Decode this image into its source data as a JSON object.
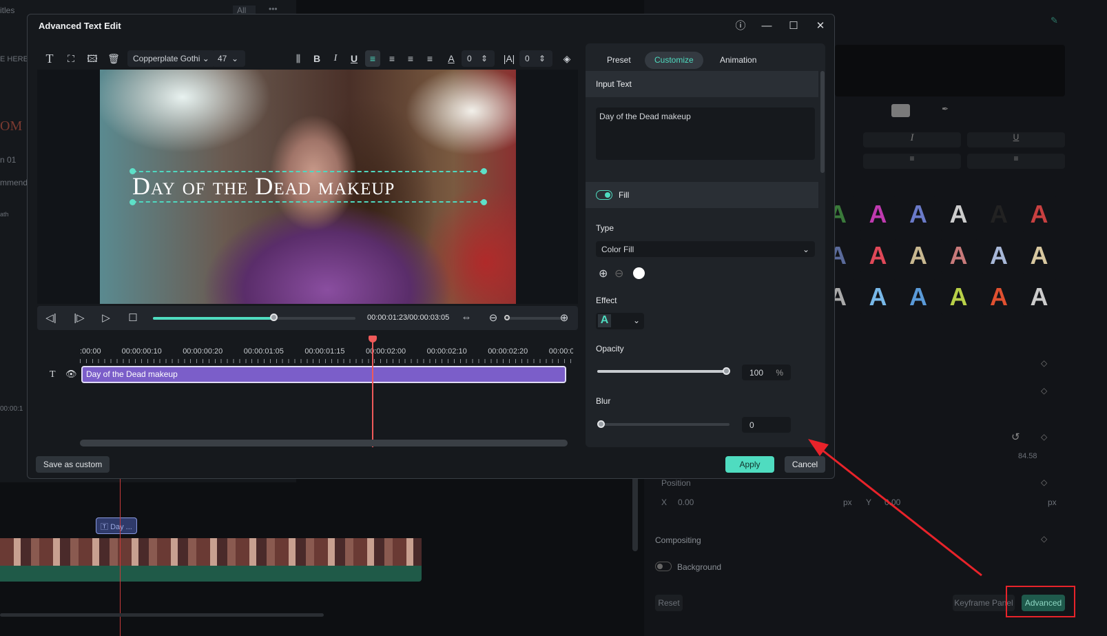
{
  "background": {
    "left_panel": {
      "titles": "itles",
      "all_filter": "All",
      "more": "•••",
      "e_here": "E HERE",
      "item1": "n 01",
      "recommend": "mmend",
      "ath": "ath",
      "timecode": "00:00:1"
    },
    "right_panel": {
      "scale_value": "84.58",
      "position_label": "Position",
      "x_label": "X",
      "x_value": "0.00",
      "x_unit": "px",
      "y_label": "Y",
      "y_value": "0.00",
      "y_unit": "px",
      "compositing_label": "Compositing",
      "background_label": "Background",
      "reset_label": "Reset",
      "keyframe_panel_label": "Keyframe Panel",
      "advanced_label": "Advanced",
      "style_glyph": "A"
    },
    "timeline": {
      "text_clip_label": "Day ..."
    }
  },
  "dialog": {
    "title": "Advanced Text Edit",
    "toolbar": {
      "font": "Copperplate Gothi",
      "size": "47",
      "char_spacing": "0",
      "line_spacing": "0"
    },
    "preview": {
      "caption": "Day of the Dead makeup"
    },
    "playback": {
      "timecode": "00:00:01:23/00:00:03:05",
      "progress_percent": 60
    },
    "timeline": {
      "ticks": [
        ":00:00",
        "00:00:00:10",
        "00:00:00:20",
        "00:00:01:05",
        "00:00:01:15",
        "00:00:02:00",
        "00:00:02:10",
        "00:00:02:20",
        "00:00:0"
      ],
      "clip_label": "Day of the Dead makeup"
    },
    "tabs": [
      {
        "label": "Preset"
      },
      {
        "label": "Customize",
        "active": true
      },
      {
        "label": "Animation"
      }
    ],
    "panel": {
      "input_text_header": "Input Text",
      "input_text_value": "Day of the Dead makeup",
      "fill_label": "Fill",
      "fill_enabled": true,
      "type_label": "Type",
      "type_value": "Color Fill",
      "fill_color": "#ffffff",
      "effect_label": "Effect",
      "effect_glyph": "A",
      "opacity_label": "Opacity",
      "opacity_value": "100",
      "opacity_unit": "%",
      "blur_label": "Blur",
      "blur_value": "0"
    },
    "save_custom_label": "Save as custom",
    "apply_label": "Apply",
    "cancel_label": "Cancel"
  },
  "colors": {
    "accent": "#4fdcc0",
    "clip": "#7b5ec9",
    "playhead": "#f05a5a",
    "annotation": "#e8232a"
  }
}
